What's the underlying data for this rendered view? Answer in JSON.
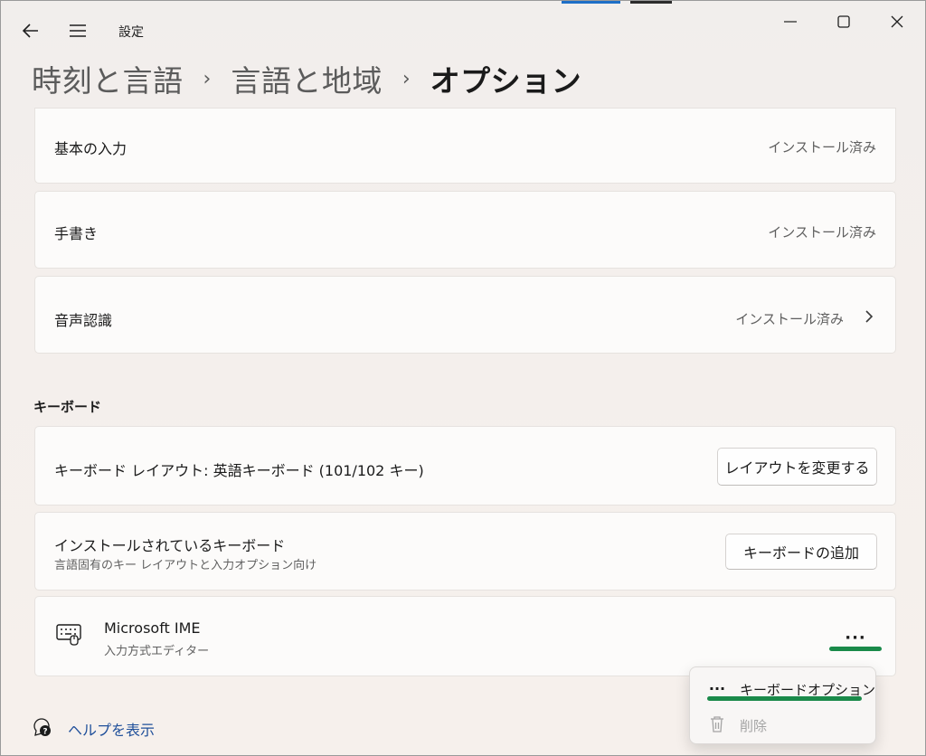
{
  "app": {
    "title": "設定",
    "accent_colors": [
      "#1e6fc7",
      "#2b2b2b"
    ]
  },
  "breadcrumb": [
    {
      "label": "時刻と言語"
    },
    {
      "label": "言語と地域"
    },
    {
      "label": "オプション"
    }
  ],
  "breadcrumb_separator": "›",
  "features": [
    {
      "label": "基本の入力",
      "status": "インストール済み"
    },
    {
      "label": "手書き",
      "status": "インストール済み"
    },
    {
      "label": "音声認識",
      "status": "インストール済み"
    }
  ],
  "keyboard": {
    "heading": "キーボード",
    "layout_label": "キーボード レイアウト: 英語キーボード (101/102 キー)",
    "change_layout_button": "レイアウトを変更する",
    "installed_title": "インストールされているキーボード",
    "installed_sub": "言語固有のキー レイアウトと入力オプション向け",
    "add_button": "キーボードの追加",
    "ime_name": "Microsoft IME",
    "ime_sub": "入力方式エディター",
    "more_label": "···"
  },
  "context_menu": {
    "items": [
      {
        "label": "キーボードオプション",
        "icon": "more-icon",
        "icon_glyph": "···",
        "enabled": true
      },
      {
        "label": "削除",
        "icon": "trash-icon",
        "enabled": false
      }
    ]
  },
  "help": {
    "label": "ヘルプを表示"
  },
  "highlight_color": "#1a8a4a",
  "link_color": "#1f4f9a"
}
